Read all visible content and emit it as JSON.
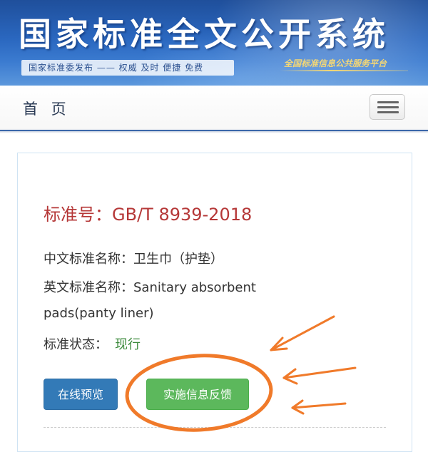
{
  "banner": {
    "title": "国家标准全文公开系统",
    "tagline": "国家标准委发布 —— 权威 及时 便捷 免费",
    "slogan": "全国标准信息公共服务平台"
  },
  "navbar": {
    "home_label": "首 页",
    "menu_icon": "hamburger-menu-icon"
  },
  "standard": {
    "number_label": "标准号：",
    "number": "GB/T 8939-2018",
    "cn_name_label": "中文标准名称：",
    "cn_name": "卫生巾（护垫）",
    "en_name_label": "英文标准名称：",
    "en_name_line1": "Sanitary absorbent",
    "en_name_line2": "pads(panty liner)",
    "status_label": "标准状态：",
    "status_value": "现行"
  },
  "actions": {
    "preview_label": "在线预览",
    "feedback_label": "实施信息反馈"
  },
  "colors": {
    "title_red": "#b53737",
    "status_green": "#3d8b3d",
    "primary_blue": "#337ab7",
    "success_green": "#5cb85c",
    "annotation_orange": "#f07a2a"
  }
}
